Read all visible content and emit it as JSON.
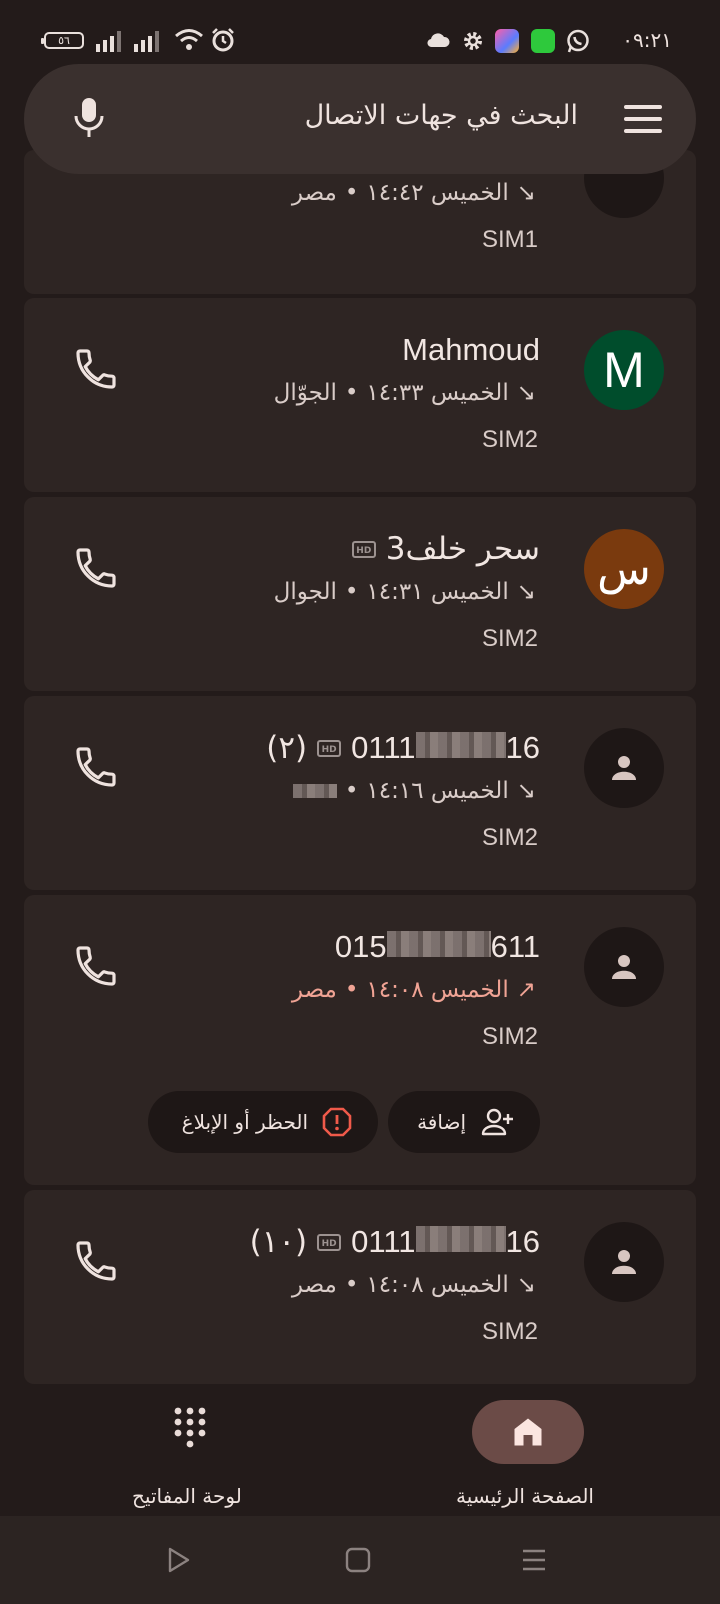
{
  "status_bar": {
    "time": "٠٩:٢١",
    "battery": "٥٦",
    "icons": [
      "battery-icon",
      "signal-icon",
      "signal-icon",
      "wifi-icon",
      "alarm-icon",
      "cloud-icon",
      "settings-icon",
      "app-icon",
      "app-icon",
      "whatsapp-icon"
    ]
  },
  "search": {
    "placeholder": "البحث في جهات الاتصال",
    "icons": [
      "mic-icon",
      "menu-icon"
    ]
  },
  "calls": [
    {
      "name": "",
      "time_text": "الخميس ١٤:٤٢",
      "label": "مصر",
      "sim": "SIM1",
      "direction": "incoming",
      "partial": true
    },
    {
      "name": "Mahmoud",
      "avatar_letter": "M",
      "avatar_color": "#004d2c",
      "time_text": "الخميس ١٤:٣٣",
      "label": "الجوّال",
      "sim": "SIM2",
      "direction": "incoming"
    },
    {
      "name": "سحر خلف3",
      "avatar_letter": "س",
      "avatar_color": "#7a3a0e",
      "hd": true,
      "time_text": "الخميس ١٤:٣١",
      "label": "الجوال",
      "sim": "SIM2",
      "direction": "incoming"
    },
    {
      "number_start": "0111",
      "number_end": "16",
      "count": "(٢)",
      "hd": true,
      "time_text": "الخميس ١٤:١٦",
      "sim": "SIM2",
      "direction": "incoming"
    },
    {
      "number_start": "015",
      "number_end": "611",
      "time_text": "الخميس ١٤:٠٨",
      "label": "مصر",
      "sim": "SIM2",
      "direction": "missed",
      "expanded": true,
      "actions": {
        "add": "إضافة",
        "block": "الحظر أو الإبلاغ"
      }
    },
    {
      "number_start": "0111",
      "number_end": "16",
      "count": "(١٠)",
      "hd": true,
      "time_text": "الخميس ١٤:٠٨",
      "label": "مصر",
      "sim": "SIM2",
      "direction": "incoming"
    }
  ],
  "hd_label": "HD",
  "separator": "•",
  "bottom_nav": {
    "home": "الصفحة الرئيسية",
    "keypad": "لوحة المفاتيح"
  },
  "colors": {
    "background": "#231b1a",
    "card": "#2e2523",
    "search": "#3a302e",
    "missed": "#f0a394",
    "block_icon": "#f05a4a",
    "home_pill": "#6b4b47"
  }
}
